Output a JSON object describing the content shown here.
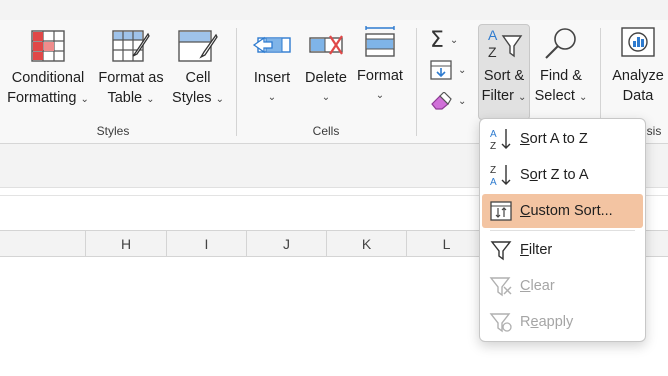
{
  "ribbon": {
    "styles_group": {
      "label": "Styles",
      "conditional_formatting": {
        "line1": "Conditional",
        "line2": "Formatting"
      },
      "format_as_table": {
        "line1": "Format as",
        "line2": "Table"
      },
      "cell_styles": {
        "line1": "Cell",
        "line2": "Styles"
      }
    },
    "cells_group": {
      "label": "Cells",
      "insert": {
        "label": "Insert"
      },
      "delete": {
        "label": "Delete"
      },
      "format": {
        "label": "Format"
      }
    },
    "editing_group": {
      "sort_filter": {
        "line1": "Sort &",
        "line2": "Filter"
      },
      "find_select": {
        "line1": "Find &",
        "line2": "Select"
      }
    },
    "analysis_group": {
      "analyze_data": {
        "line1": "Analyze",
        "line2": "Data"
      },
      "label_partial": "sis"
    }
  },
  "columns": [
    "H",
    "I",
    "J",
    "K",
    "L"
  ],
  "menu": {
    "items": [
      {
        "pre": "",
        "ul": "S",
        "post": "ort A to Z",
        "icon": "sort-az-icon",
        "state": "normal"
      },
      {
        "pre": "S",
        "ul": "o",
        "post": "rt Z to A",
        "icon": "sort-za-icon",
        "state": "normal"
      },
      {
        "pre": "",
        "ul": "C",
        "post": "ustom Sort...",
        "icon": "custom-sort-icon",
        "state": "highlighted"
      },
      {
        "pre": "",
        "ul": "F",
        "post": "ilter",
        "icon": "filter-icon",
        "state": "normal"
      },
      {
        "pre": "",
        "ul": "C",
        "post": "lear",
        "icon": "clear-filter-icon",
        "state": "disabled"
      },
      {
        "pre": "R",
        "ul": "e",
        "post": "apply",
        "icon": "reapply-icon",
        "state": "disabled"
      }
    ]
  },
  "colors": {
    "highlight": "#f3c4a2",
    "accent_blue": "#2e7bcf",
    "accent_red": "#e04848"
  }
}
